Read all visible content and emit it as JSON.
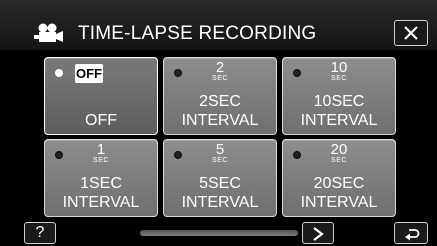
{
  "header": {
    "title": "TIME-LAPSE RECORDING",
    "icon": "video-camera-icon",
    "close_icon": "close-icon"
  },
  "options": [
    {
      "id": "off",
      "badge": "OFF",
      "label": "OFF",
      "selected": true
    },
    {
      "id": "2sec",
      "number": "2",
      "unit": "SEC",
      "label1": "2SEC",
      "label2": "INTERVAL",
      "selected": false
    },
    {
      "id": "10sec",
      "number": "10",
      "unit": "SEC",
      "label1": "10SEC",
      "label2": "INTERVAL",
      "selected": false
    },
    {
      "id": "1sec",
      "number": "1",
      "unit": "SEC",
      "label1": "1SEC",
      "label2": "INTERVAL",
      "selected": false
    },
    {
      "id": "5sec",
      "number": "5",
      "unit": "SEC",
      "label1": "5SEC",
      "label2": "INTERVAL",
      "selected": false
    },
    {
      "id": "20sec",
      "number": "20",
      "unit": "SEC",
      "label1": "20SEC",
      "label2": "INTERVAL",
      "selected": false
    }
  ],
  "footer": {
    "help_label": "?",
    "next_icon": "chevron-right-icon",
    "back_icon": "return-arrow-icon"
  },
  "colors": {
    "tile": "#7e7e7e",
    "tile_border": "#d8d8d8",
    "background": "#000000"
  }
}
